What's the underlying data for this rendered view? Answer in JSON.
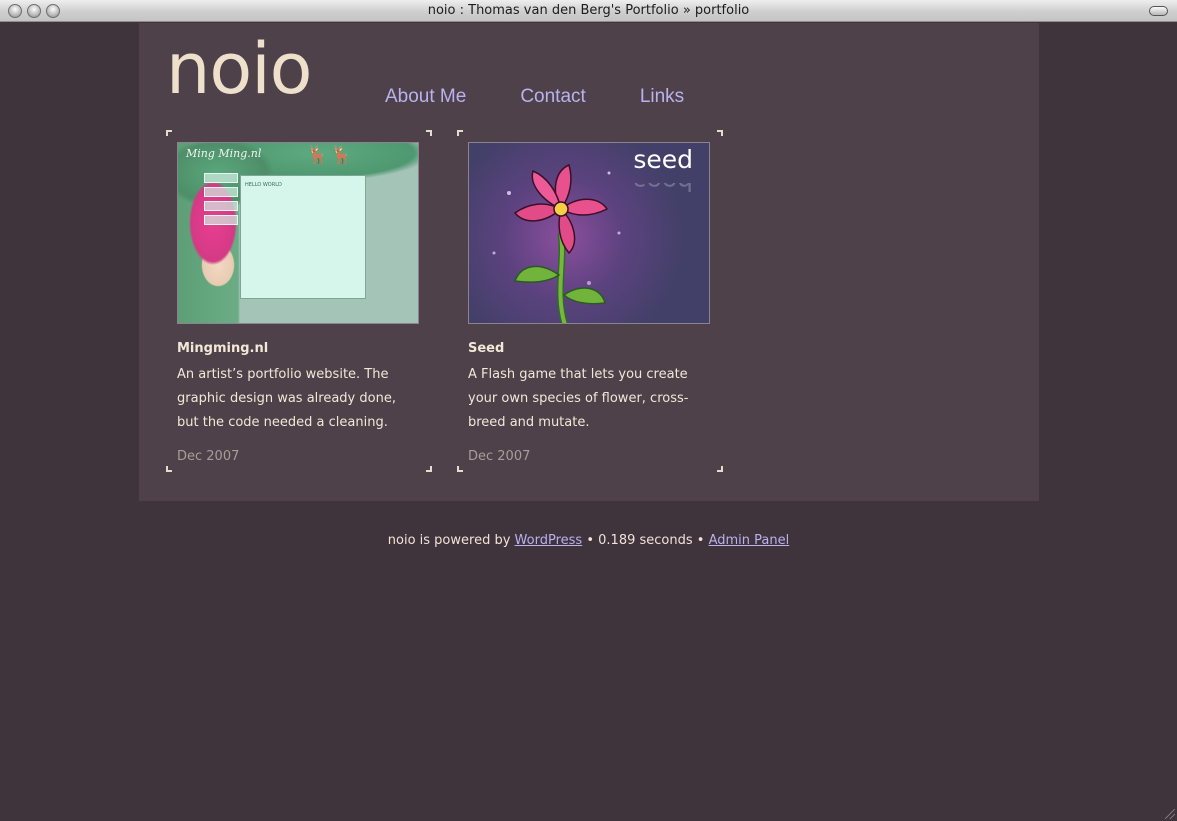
{
  "window": {
    "title": "noio : Thomas van den Berg's Portfolio » portfolio"
  },
  "site": {
    "logo": "noio"
  },
  "nav": {
    "items": [
      "About Me",
      "Contact",
      "Links"
    ]
  },
  "portfolio": {
    "items": [
      {
        "title": "Mingming.nl",
        "description": "An artist’s portfolio website. The graphic design was already done, but the code needed a cleaning.",
        "date": "Dec 2007",
        "thumb_title": "Ming Ming.nl",
        "thumb_panel": "HELLO WORLD"
      },
      {
        "title": "Seed",
        "description": "A Flash game that lets you create your own species of flower, cross-breed and mutate.",
        "date": "Dec 2007",
        "thumb_title": "seed"
      }
    ]
  },
  "footer": {
    "prefix": "noio is powered by",
    "wordpress_link": "WordPress",
    "sep1": "•",
    "timing": "0.189 seconds",
    "sep2": "•",
    "admin_link": "Admin Panel"
  },
  "colors": {
    "background": "#3f333c",
    "content": "#4e414a",
    "logo": "#efe0cc",
    "link": "#b8b2ee",
    "text": "#f3e7d6",
    "date": "#a89d98"
  }
}
